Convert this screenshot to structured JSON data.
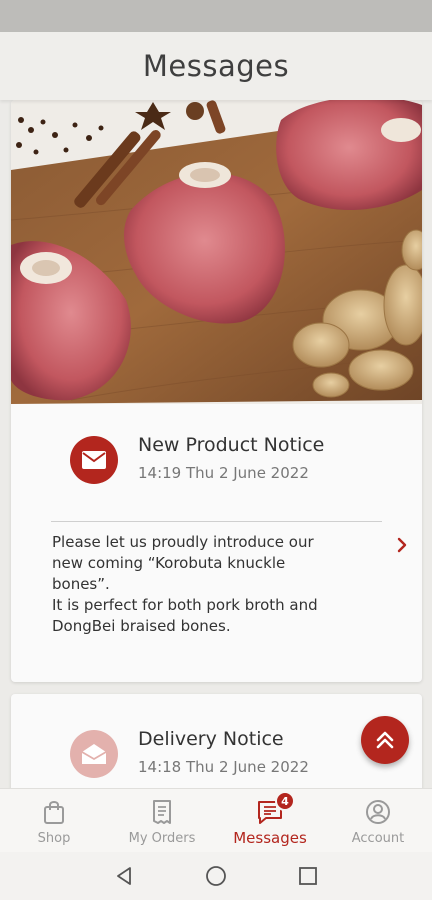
{
  "header": {
    "title": "Messages"
  },
  "messages": [
    {
      "title": "New Product Notice",
      "date": "14:19 Thu 2 June 2022",
      "body_lines": [
        "Please let us proudly introduce our",
        "new coming “Korobuta knuckle",
        "bones”.",
        "It is perfect for both pork broth and",
        "DongBei braised bones."
      ],
      "icon": "mail-icon"
    },
    {
      "title": "Delivery Notice",
      "date": "14:18 Thu 2 June 2022",
      "icon": "mail-open-icon"
    }
  ],
  "nav": {
    "items": [
      {
        "label": "Shop",
        "icon": "shopping-bag-icon"
      },
      {
        "label": "My Orders",
        "icon": "receipt-icon"
      },
      {
        "label": "Messages",
        "icon": "chat-icon",
        "badge": "4"
      },
      {
        "label": "Account",
        "icon": "account-icon"
      }
    ],
    "active": "Messages"
  },
  "colors": {
    "accent": "#b3261e",
    "accent_faded": "#e3b1ad",
    "header_bg": "#efeeeb",
    "text": "#333333"
  }
}
